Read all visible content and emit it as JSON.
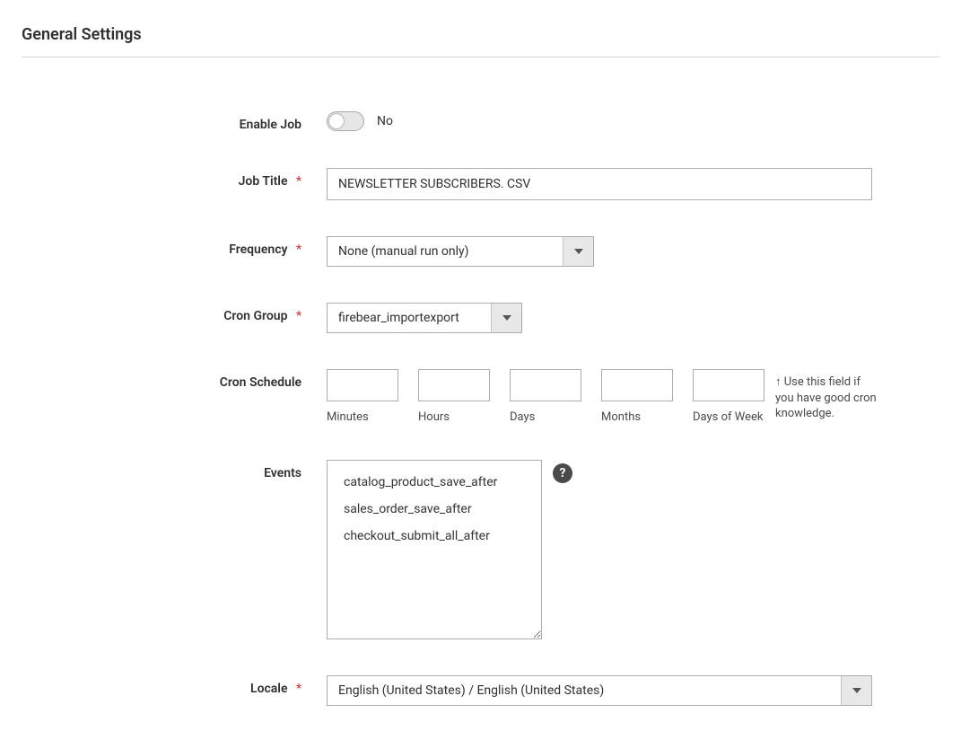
{
  "section": {
    "title": "General Settings"
  },
  "labels": {
    "enable_job": "Enable Job",
    "job_title": "Job Title",
    "frequency": "Frequency",
    "cron_group": "Cron Group",
    "cron_schedule": "Cron Schedule",
    "events": "Events",
    "locale": "Locale"
  },
  "fields": {
    "enable_job": {
      "state_label": "No"
    },
    "job_title": {
      "value": "NEWSLETTER SUBSCRIBERS. CSV"
    },
    "frequency": {
      "value": "None (manual run only)"
    },
    "cron_group": {
      "value": "firebear_importexport"
    },
    "cron_schedule": {
      "sublabels": {
        "minutes": "Minutes",
        "hours": "Hours",
        "days": "Days",
        "months": "Months",
        "dow": "Days of Week"
      },
      "hint": "↑ Use this field if you have good cron knowledge."
    },
    "events": {
      "options": [
        "catalog_product_save_after",
        "sales_order_save_after",
        "checkout_submit_all_after"
      ]
    },
    "locale": {
      "value": "English (United States) / English (United States)"
    }
  },
  "marks": {
    "required": "*"
  },
  "icons": {
    "help": "?"
  }
}
